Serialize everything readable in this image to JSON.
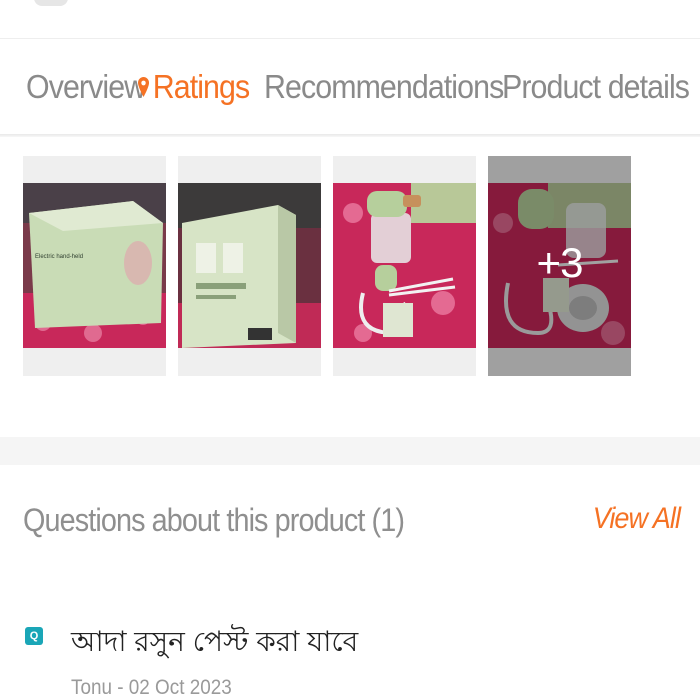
{
  "tabs": [
    {
      "label": "Overview",
      "active": false
    },
    {
      "label": "Ratings",
      "active": true
    },
    {
      "label": "Recommendations",
      "active": false
    },
    {
      "label": "Product details",
      "active": false
    }
  ],
  "gallery": {
    "photos": [
      {
        "icon": "product-box-photo",
        "caption": "Electric hand-held"
      },
      {
        "icon": "product-box-back-photo"
      },
      {
        "icon": "chopper-unboxed-photo"
      },
      {
        "icon": "chopper-accessories-photo"
      }
    ],
    "more_count": "+3"
  },
  "questions": {
    "title": "Questions about this product (1)",
    "view_all": "View All",
    "items": [
      {
        "badge": "Q",
        "text": "আদা রসুন পেস্ট করা যাবে",
        "meta": "Tonu - 02 Oct 2023"
      }
    ]
  },
  "colors": {
    "accent": "#f57224",
    "tab_inactive": "#8a8a8a",
    "question_badge": "#1aa6b7"
  }
}
